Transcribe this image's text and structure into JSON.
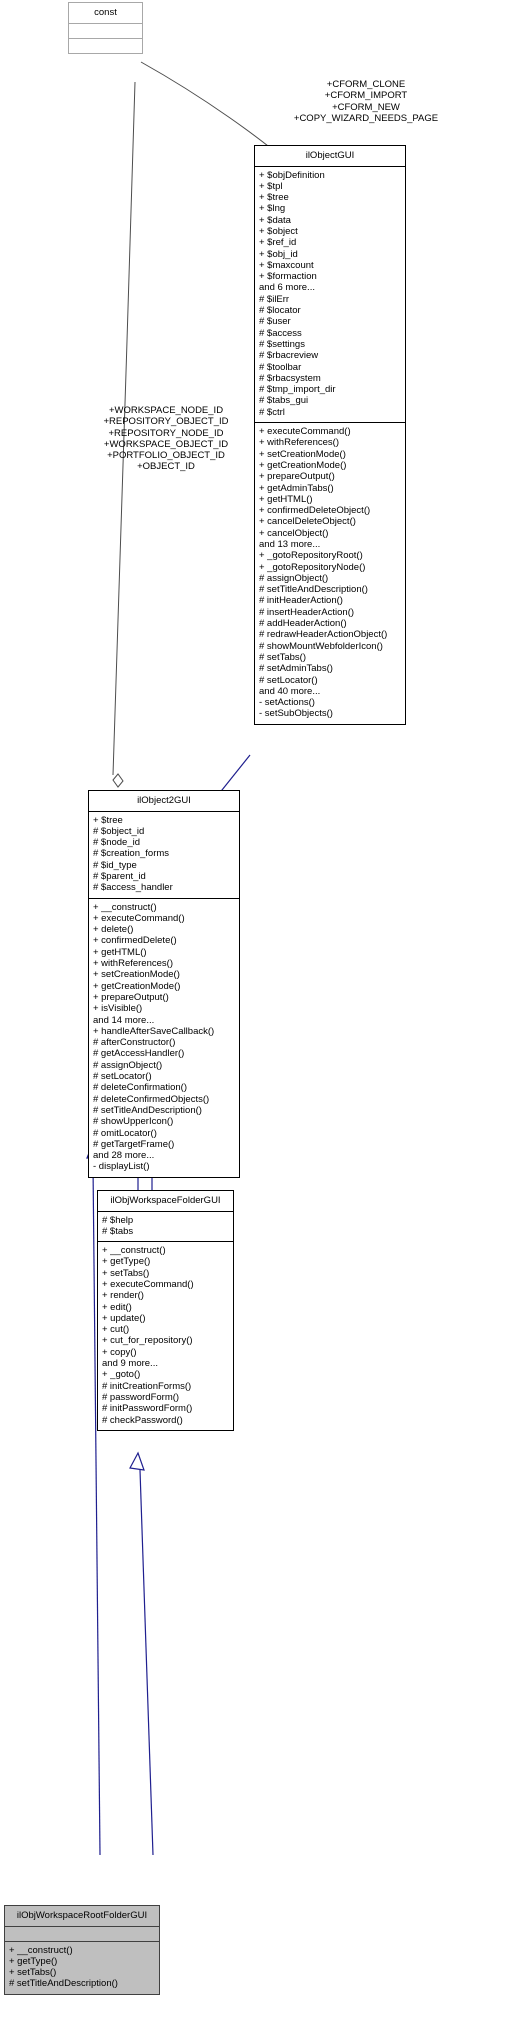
{
  "diagram": {
    "type": "uml-class-inheritance-graph",
    "title": "ilObjWorkspaceRootFolderGUI inheritance diagram"
  },
  "edge_labels": {
    "const_to_ilObjectGUI": "+CFORM_CLONE\n+CFORM_IMPORT\n+CFORM_NEW\n+COPY_WIZARD_NEEDS_PAGE",
    "const_to_ilObject2GUI": "+WORKSPACE_NODE_ID\n+REPOSITORY_OBJECT_ID\n+REPOSITORY_NODE_ID\n+WORKSPACE_OBJECT_ID\n+PORTFOLIO_OBJECT_ID\n+OBJECT_ID"
  },
  "classes": {
    "const": {
      "name": "const",
      "attributes": [],
      "operations": []
    },
    "ilObjectGUI": {
      "name": "ilObjectGUI",
      "attributes": [
        "+ $objDefinition",
        "+ $tpl",
        "+ $tree",
        "+ $lng",
        "+ $data",
        "+ $object",
        "+ $ref_id",
        "+ $obj_id",
        "+ $maxcount",
        "+ $formaction",
        "and 6 more...",
        "# $ilErr",
        "# $locator",
        "# $user",
        "# $access",
        "# $settings",
        "# $rbacreview",
        "# $toolbar",
        "# $rbacsystem",
        "# $tmp_import_dir",
        "# $tabs_gui",
        "# $ctrl"
      ],
      "operations": [
        "+ executeCommand()",
        "+ withReferences()",
        "+ setCreationMode()",
        "+ getCreationMode()",
        "+ prepareOutput()",
        "+ getAdminTabs()",
        "+ getHTML()",
        "+ confirmedDeleteObject()",
        "+ cancelDeleteObject()",
        "+ cancelObject()",
        "and 13 more...",
        "+ _gotoRepositoryRoot()",
        "+ _gotoRepositoryNode()",
        "# assignObject()",
        "# setTitleAndDescription()",
        "# initHeaderAction()",
        "# insertHeaderAction()",
        "# addHeaderAction()",
        "# redrawHeaderActionObject()",
        "# showMountWebfolderIcon()",
        "# setTabs()",
        "# setAdminTabs()",
        "# setLocator()",
        "and 40 more...",
        "- setActions()",
        "- setSubObjects()"
      ]
    },
    "ilObject2GUI": {
      "name": "ilObject2GUI",
      "attributes": [
        "+ $tree",
        "# $object_id",
        "# $node_id",
        "# $creation_forms",
        "# $id_type",
        "# $parent_id",
        "# $access_handler"
      ],
      "operations": [
        "+ __construct()",
        "+ executeCommand()",
        "+ delete()",
        "+ confirmedDelete()",
        "+ getHTML()",
        "+ withReferences()",
        "+ setCreationMode()",
        "+ getCreationMode()",
        "+ prepareOutput()",
        "+ isVisible()",
        "and 14 more...",
        "+ handleAfterSaveCallback()",
        "# afterConstructor()",
        "# getAccessHandler()",
        "# assignObject()",
        "# setLocator()",
        "# deleteConfirmation()",
        "# deleteConfirmedObjects()",
        "# setTitleAndDescription()",
        "# showUpperIcon()",
        "# omitLocator()",
        "# getTargetFrame()",
        "and 28 more...",
        "- displayList()"
      ]
    },
    "ilObjWorkspaceFolderGUI": {
      "name": "ilObjWorkspaceFolderGUI",
      "attributes": [
        "# $help",
        "# $tabs"
      ],
      "operations": [
        "+ __construct()",
        "+ getType()",
        "+ setTabs()",
        "+ executeCommand()",
        "+ render()",
        "+ edit()",
        "+ update()",
        "+ cut()",
        "+ cut_for_repository()",
        "+ copy()",
        "and 9 more...",
        "+ _goto()",
        "# initCreationForms()",
        "# passwordForm()",
        "# initPasswordForm()",
        "# checkPassword()"
      ]
    },
    "ilObjWorkspaceRootFolderGUI": {
      "name": "ilObjWorkspaceRootFolderGUI",
      "attributes": [],
      "operations": [
        "+ __construct()",
        "+ getType()",
        "+ setTabs()",
        "# setTitleAndDescription()"
      ]
    }
  },
  "colors": {
    "inheritance_edge": "#1f1f8f",
    "association_edge": "#4d4d4d",
    "node_border": "#000000",
    "highlight_fill": "#bfbfbf",
    "background": "#ffffff"
  }
}
